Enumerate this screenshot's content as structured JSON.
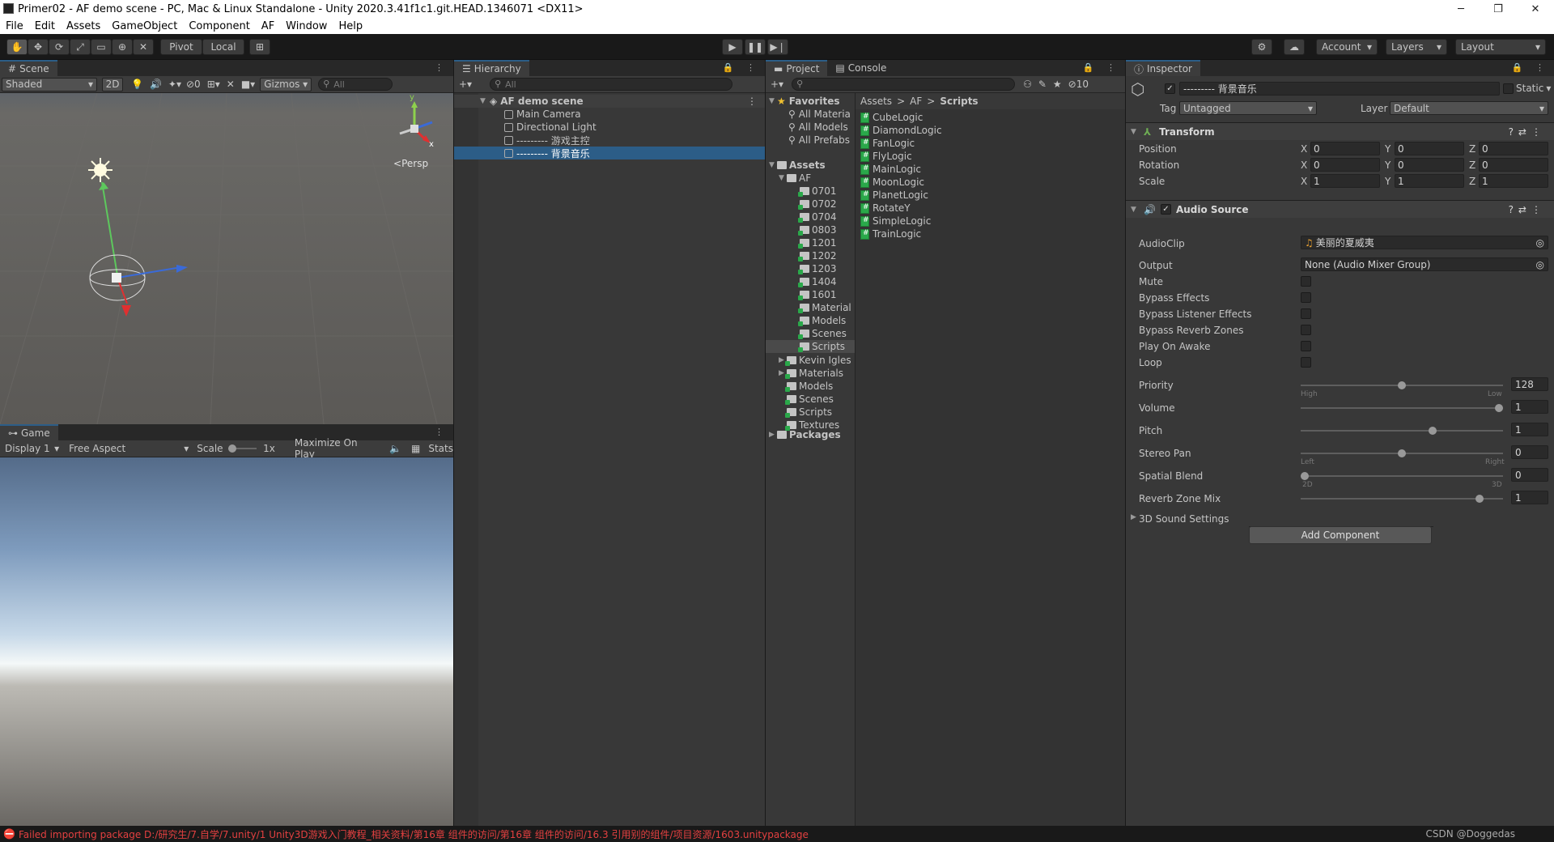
{
  "window": {
    "title": "Primer02 - AF demo scene - PC, Mac & Linux Standalone - Unity 2020.3.41f1c1.git.HEAD.1346071 <DX11>"
  },
  "menu": [
    "File",
    "Edit",
    "Assets",
    "GameObject",
    "Component",
    "AF",
    "Window",
    "Help"
  ],
  "toolbar": {
    "pivot": "Pivot",
    "local": "Local",
    "account": "Account",
    "layers": "Layers",
    "layout": "Layout"
  },
  "scene": {
    "tab": "Scene",
    "shading": "Shaded",
    "mode2d": "2D",
    "hidden_count": "0",
    "gizmos": "Gizmos",
    "search_placeholder": "All",
    "persp": "Persp",
    "axis_y": "y",
    "axis_x": "x"
  },
  "game": {
    "tab": "Game",
    "display": "Display 1",
    "aspect": "Free Aspect",
    "scale_label": "Scale",
    "scale_value": "1x",
    "maximize": "Maximize On Play",
    "stats": "Stats"
  },
  "hierarchy": {
    "tab": "Hierarchy",
    "search_placeholder": "All",
    "scene_name": "AF demo scene",
    "items": [
      "Main Camera",
      "Directional Light",
      "--------- 游戏主控",
      "--------- 背景音乐"
    ]
  },
  "project": {
    "tab_project": "Project",
    "tab_console": "Console",
    "hidden_count": "10",
    "favorites_label": "Favorites",
    "favorites": [
      "All Materia",
      "All Models",
      "All Prefabs"
    ],
    "assets_label": "Assets",
    "af_label": "AF",
    "af_children": [
      "0701",
      "0702",
      "0704",
      "0803",
      "1201",
      "1202",
      "1203",
      "1404",
      "1601",
      "Material",
      "Models",
      "Scenes",
      "Scripts"
    ],
    "assets_children": [
      "Kevin Igles",
      "Materials",
      "Models",
      "Scenes",
      "Scripts",
      "Textures"
    ],
    "packages_label": "Packages",
    "breadcrumb": [
      "Assets",
      "AF",
      "Scripts"
    ],
    "scripts": [
      "CubeLogic",
      "DiamondLogic",
      "FanLogic",
      "FlyLogic",
      "MainLogic",
      "MoonLogic",
      "PlanetLogic",
      "RotateY",
      "SimpleLogic",
      "TrainLogic"
    ]
  },
  "inspector": {
    "tab": "Inspector",
    "object_name": "--------- 背景音乐",
    "static_label": "Static",
    "tag_label": "Tag",
    "tag_value": "Untagged",
    "layer_label": "Layer",
    "layer_value": "Default",
    "transform": {
      "title": "Transform",
      "position_label": "Position",
      "rotation_label": "Rotation",
      "scale_label": "Scale",
      "position": [
        "0",
        "0",
        "0"
      ],
      "rotation": [
        "0",
        "0",
        "0"
      ],
      "scale": [
        "1",
        "1",
        "1"
      ],
      "axes": [
        "X",
        "Y",
        "Z"
      ]
    },
    "audio": {
      "title": "Audio Source",
      "audioclip_label": "AudioClip",
      "audioclip_value": "美丽的夏威夷",
      "output_label": "Output",
      "output_value": "None (Audio Mixer Group)",
      "mute": "Mute",
      "bypass_effects": "Bypass Effects",
      "bypass_listener": "Bypass Listener Effects",
      "bypass_reverb": "Bypass Reverb Zones",
      "play_on_awake": "Play On Awake",
      "loop": "Loop",
      "priority_label": "Priority",
      "priority_value": "128",
      "priority_min": "High",
      "priority_max": "Low",
      "volume_label": "Volume",
      "volume_value": "1",
      "pitch_label": "Pitch",
      "pitch_value": "1",
      "stereo_label": "Stereo Pan",
      "stereo_value": "0",
      "stereo_min": "Left",
      "stereo_max": "Right",
      "spatial_label": "Spatial Blend",
      "spatial_value": "0",
      "spatial_min": "2D",
      "spatial_max": "3D",
      "reverb_label": "Reverb Zone Mix",
      "reverb_value": "1",
      "sound3d_label": "3D Sound Settings",
      "slider_fractions": {
        "priority": 0.5,
        "volume": 1.0,
        "pitch": 0.66,
        "stereo": 0.5,
        "spatial": 0.0,
        "reverb": 0.9
      }
    },
    "add_component": "Add Component"
  },
  "status": {
    "error": "Failed importing package D:/研究生/7.自学/7.unity/1 Unity3D游戏入门教程_相关资料/第16章 组件的访问/第16章 组件的访问/16.3 引用别的组件/项目资源/1603.unitypackage",
    "watermark": "CSDN @Doggedas"
  }
}
